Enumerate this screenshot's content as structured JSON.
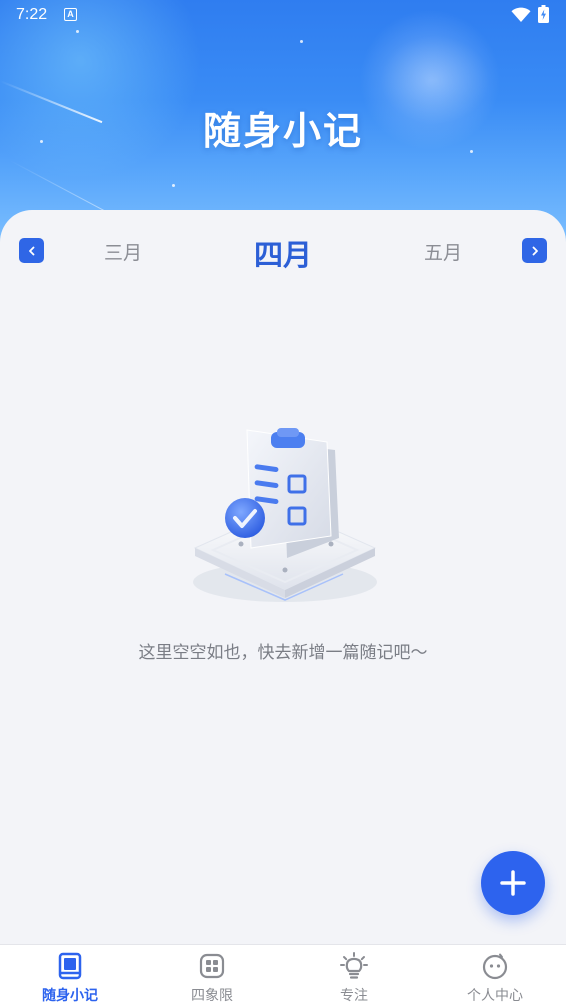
{
  "status": {
    "time": "7:22",
    "notification_badge": "A"
  },
  "header": {
    "title": "随身小记"
  },
  "month_nav": {
    "prev_month": "三月",
    "current_month": "四月",
    "next_month": "五月"
  },
  "empty_state": {
    "message": "这里空空如也，快去新增一篇随记吧～",
    "icon": "clipboard-check-illustration"
  },
  "fab": {
    "icon": "plus-icon"
  },
  "tabs": [
    {
      "label": "随身小记",
      "icon": "notebook-icon",
      "active": true
    },
    {
      "label": "四象限",
      "icon": "grid-icon",
      "active": false
    },
    {
      "label": "专注",
      "icon": "lightbulb-icon",
      "active": false
    },
    {
      "label": "个人中心",
      "icon": "smiley-icon",
      "active": false
    }
  ],
  "colors": {
    "accent": "#2d63ee",
    "hero_top": "#2f7df0",
    "background": "#f3f4f8",
    "muted_text": "#8b8d94"
  }
}
